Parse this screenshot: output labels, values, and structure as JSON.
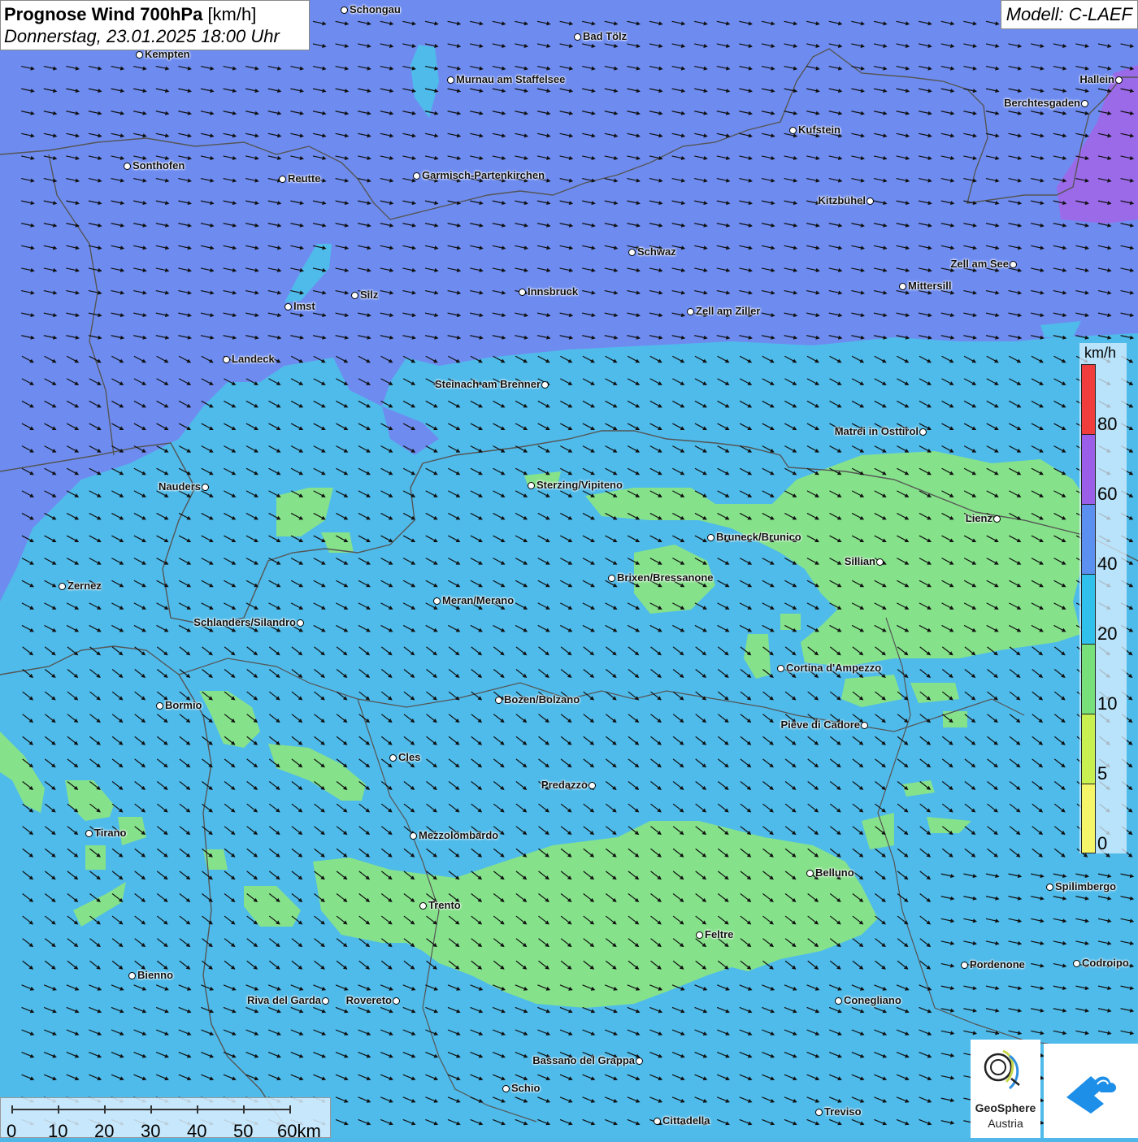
{
  "title": {
    "main": "Prognose Wind 700hPa",
    "unit": "[km/h]",
    "datetime": "Donnerstag, 23.01.2025 18:00 Uhr"
  },
  "model": "Modell: C-LAEF",
  "legend": {
    "unit": "km/h",
    "labels": [
      "80",
      "60",
      "40",
      "20",
      "10",
      "5",
      "0"
    ],
    "colors": [
      "#f03c3c",
      "#9b5ee8",
      "#5b8ff0",
      "#2fc0ec",
      "#78e07a",
      "#c8f050",
      "#f5f56a"
    ]
  },
  "scale": {
    "ticks": [
      "0",
      "10",
      "20",
      "30",
      "40",
      "50",
      "60km"
    ]
  },
  "logo": {
    "name": "GeoSphere",
    "sub": "Austria"
  },
  "cities": [
    {
      "name": "Schongau"
    },
    {
      "name": "Bad Tölz"
    },
    {
      "name": "Kempten"
    },
    {
      "name": "Murnau am Staffelsee"
    },
    {
      "name": "Hallein"
    },
    {
      "name": "Berchtesgaden"
    },
    {
      "name": "Kufstein"
    },
    {
      "name": "Sonthofen"
    },
    {
      "name": "Reutte"
    },
    {
      "name": "Garmisch-Partenkirchen"
    },
    {
      "name": "Kitzbühel"
    },
    {
      "name": "Schwaz"
    },
    {
      "name": "Zell am See"
    },
    {
      "name": "Mittersill"
    },
    {
      "name": "Silz"
    },
    {
      "name": "Innsbruck"
    },
    {
      "name": "Imst"
    },
    {
      "name": "Zell am Ziller"
    },
    {
      "name": "Landeck"
    },
    {
      "name": "Steinach am Brenner"
    },
    {
      "name": "Matrei in Osttirol"
    },
    {
      "name": "Nauders"
    },
    {
      "name": "Sterzing/Vipiteno"
    },
    {
      "name": "Lienz"
    },
    {
      "name": "Bruneck/Brunico"
    },
    {
      "name": "Sillian"
    },
    {
      "name": "Brixen/Bressanone"
    },
    {
      "name": "Zernez"
    },
    {
      "name": "Meran/Merano"
    },
    {
      "name": "Schlanders/Silandro"
    },
    {
      "name": "Cortina d'Ampezzo"
    },
    {
      "name": "Bozen/Bolzano"
    },
    {
      "name": "Bormio"
    },
    {
      "name": "Pieve di Cadore"
    },
    {
      "name": "Cles"
    },
    {
      "name": "Predazzo"
    },
    {
      "name": "Tirano"
    },
    {
      "name": "Mezzolombardo"
    },
    {
      "name": "Belluno"
    },
    {
      "name": "Spilimbergo"
    },
    {
      "name": "Trento"
    },
    {
      "name": "Feltre"
    },
    {
      "name": "Pordenone"
    },
    {
      "name": "Codroipo"
    },
    {
      "name": "Bienno"
    },
    {
      "name": "Riva del Garda"
    },
    {
      "name": "Rovereto"
    },
    {
      "name": "Conegliano"
    },
    {
      "name": "Bassano del Grappa"
    },
    {
      "name": "Schio"
    },
    {
      "name": "Treviso"
    },
    {
      "name": "Cittadella"
    }
  ]
}
